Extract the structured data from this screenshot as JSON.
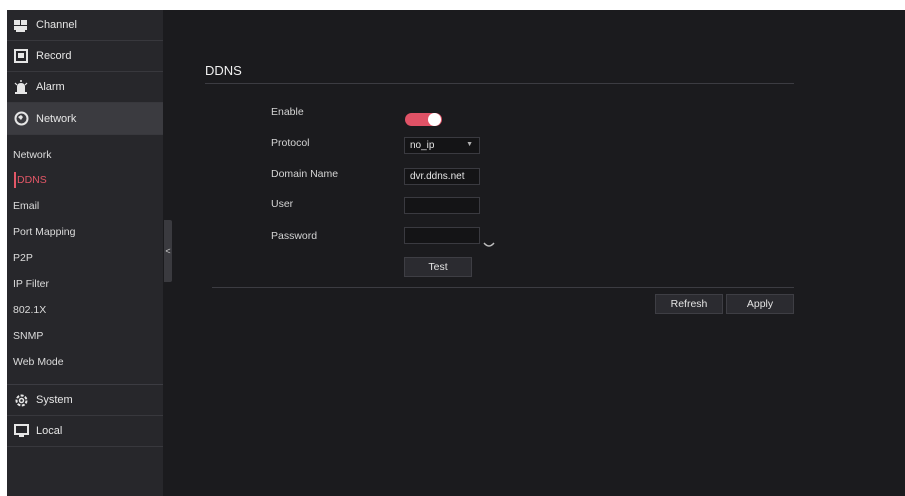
{
  "sidebar": {
    "main_items": [
      {
        "label": "Channel",
        "icon": "camera-icon"
      },
      {
        "label": "Record",
        "icon": "record-icon"
      },
      {
        "label": "Alarm",
        "icon": "alarm-icon"
      },
      {
        "label": "Network",
        "icon": "network-icon"
      },
      {
        "label": "System",
        "icon": "gear-icon"
      },
      {
        "label": "Local",
        "icon": "monitor-icon"
      }
    ],
    "sub_items": [
      {
        "label": "Network"
      },
      {
        "label": "DDNS"
      },
      {
        "label": "Email"
      },
      {
        "label": "Port Mapping"
      },
      {
        "label": "P2P"
      },
      {
        "label": "IP Filter"
      },
      {
        "label": "802.1X"
      },
      {
        "label": "SNMP"
      },
      {
        "label": "Web Mode"
      }
    ],
    "collapse_glyph": "<"
  },
  "main": {
    "title": "DDNS",
    "form": {
      "enable_label": "Enable",
      "enable_on": true,
      "protocol_label": "Protocol",
      "protocol_value": "no_ip",
      "domain_label": "Domain Name",
      "domain_value": "dvr.ddns.net",
      "user_label": "User",
      "user_value": "",
      "password_label": "Password",
      "password_value": "",
      "test_button": "Test"
    },
    "refresh_button": "Refresh",
    "apply_button": "Apply"
  },
  "colors": {
    "accent": "#e05266",
    "background": "#1b1b1e",
    "sidebar": "#27272b"
  }
}
